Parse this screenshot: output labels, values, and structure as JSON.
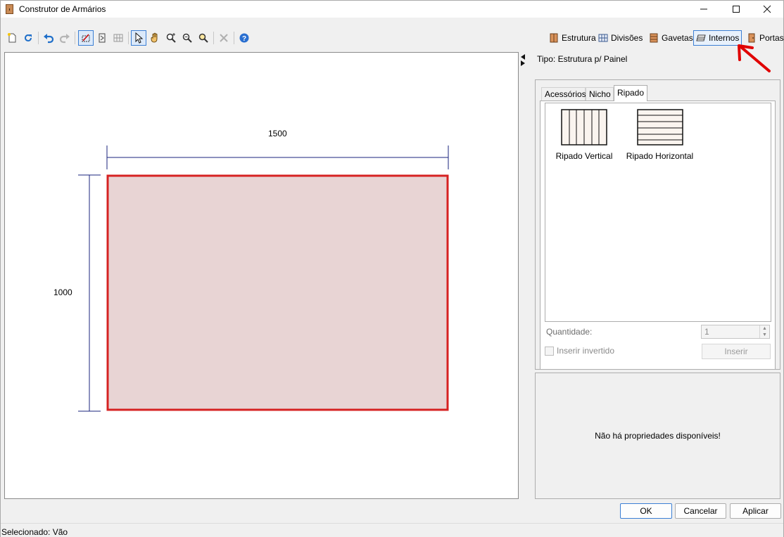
{
  "window": {
    "title": "Construtor de Armários"
  },
  "toolbar": {
    "tabs": [
      {
        "label": "Estrutura",
        "icon": "wardrobe-icon"
      },
      {
        "label": "Divisões",
        "icon": "grid-icon"
      },
      {
        "label": "Gavetas",
        "icon": "drawers-icon"
      },
      {
        "label": "Internos",
        "icon": "shelves-icon",
        "active": true
      },
      {
        "label": "Portas",
        "icon": "door-icon"
      }
    ]
  },
  "canvas": {
    "width_label": "1500",
    "height_label": "1000",
    "colors": {
      "panel_fill": "#e8d4d4",
      "panel_border": "#d62222",
      "dimension_line": "#1a237e"
    }
  },
  "panel": {
    "tipo_label": "Tipo: Estrutura p/ Painel",
    "tabs": [
      "Acessórios",
      "Nicho",
      "Ripado"
    ],
    "active_tab": "Ripado",
    "items": [
      {
        "label": "Ripado Vertical",
        "icon": "vertical-slats-icon"
      },
      {
        "label": "Ripado Horizontal",
        "icon": "horizontal-slats-icon"
      }
    ],
    "quantity_label": "Quantidade:",
    "quantity_value": "1",
    "invert_label": "Inserir invertido",
    "insert_button": "Inserir",
    "properties_empty": "Não há propriedades disponíveis!"
  },
  "buttons": {
    "ok": "OK",
    "cancel": "Cancelar",
    "apply": "Aplicar"
  },
  "status": {
    "selected": "Selecionado: Vão"
  }
}
